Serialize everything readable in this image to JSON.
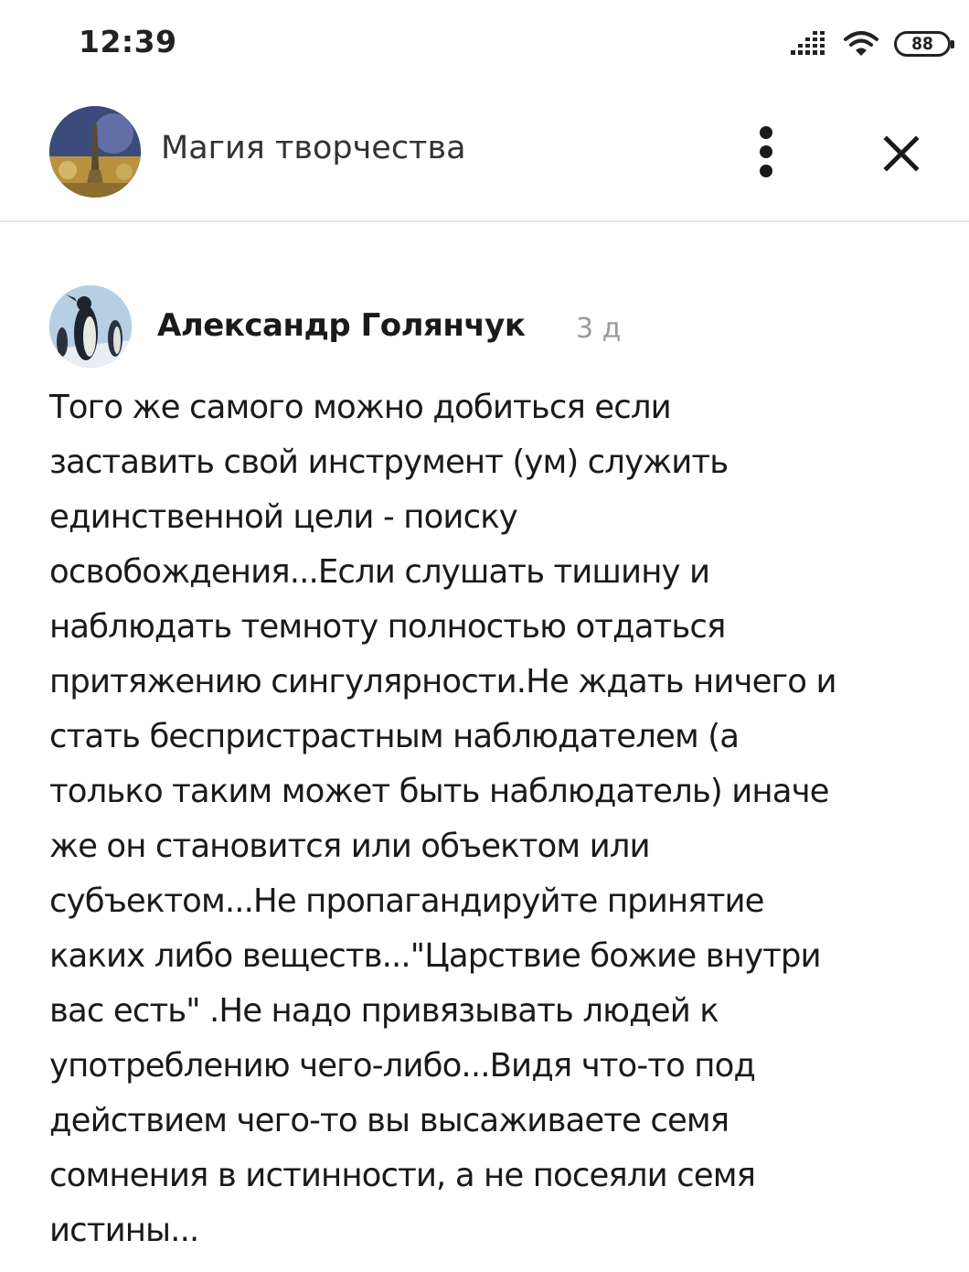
{
  "status_bar": {
    "time": "12:39",
    "battery": "88",
    "icons": [
      "signal-icon",
      "wifi-icon",
      "battery-icon"
    ]
  },
  "header": {
    "title": "Магия творчества",
    "icons": [
      "group-avatar",
      "more-vertical-icon",
      "close-icon"
    ]
  },
  "comment": {
    "author": "Александр Голянчук",
    "time": "3 д",
    "lines": [
      "Того же самого можно добиться если",
      "заставить свой инструмент (ум) служить",
      "единственной цели - поиску",
      "освобождения...Если слушать тишину и",
      "наблюдать темноту полностью отдаться",
      "притяжению сингулярности.Не ждать ничего и",
      "стать беспристрастным наблюдателем (а",
      "только таким может быть наблюдатель) иначе",
      "же он становится или объектом или",
      "субъектом...Не пропагандируйте принятие",
      "каких либо веществ...\"Царствие божие внутри",
      "вас есть\" .Не надо привязывать людей к",
      "употреблению чего-либо...Видя что-то под",
      "действием чего-то вы высаживаете семя",
      "сомнения в истинности, а не посеяли семя",
      "истины..."
    ]
  }
}
